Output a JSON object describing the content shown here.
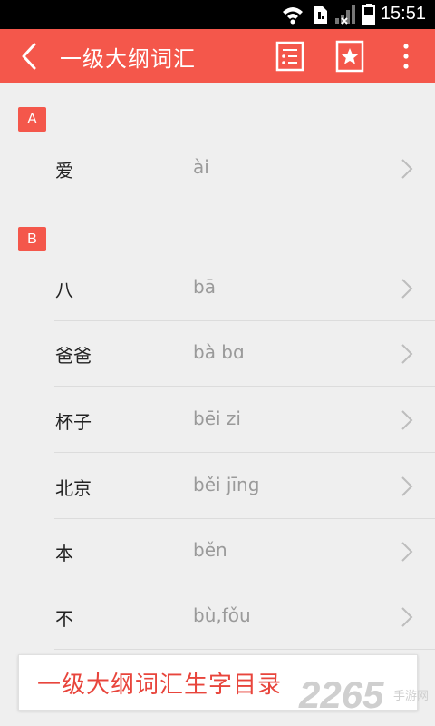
{
  "status_bar": {
    "time": "15:51"
  },
  "app_bar": {
    "title": "一级大纲词汇"
  },
  "sections": [
    {
      "letter": "A",
      "entries": [
        {
          "word": "爱",
          "pinyin": "ài"
        }
      ]
    },
    {
      "letter": "B",
      "entries": [
        {
          "word": "八",
          "pinyin": "bā"
        },
        {
          "word": "爸爸",
          "pinyin": "bà bɑ"
        },
        {
          "word": "杯子",
          "pinyin": "bēi zi"
        },
        {
          "word": "北京",
          "pinyin": "běi jīng"
        },
        {
          "word": "本",
          "pinyin": "běn"
        },
        {
          "word": "不",
          "pinyin": "bù,fǒu"
        }
      ]
    }
  ],
  "bottom_card": {
    "label": "一级大纲词汇生字目录"
  },
  "watermark": {
    "number": "2265",
    "text": "手游网"
  },
  "colors": {
    "accent": "#f4574b",
    "background": "#efefef"
  }
}
